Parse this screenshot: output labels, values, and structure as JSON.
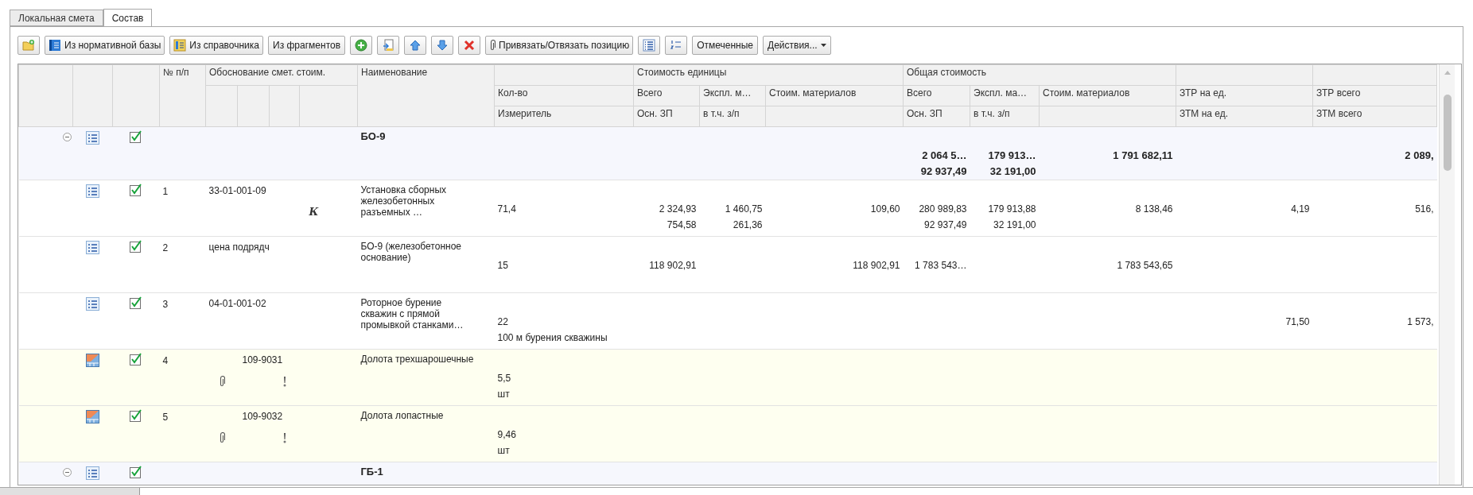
{
  "tabs": [
    {
      "label": "Локальная смета",
      "selected": false
    },
    {
      "label": "Состав",
      "selected": true
    }
  ],
  "toolbar": [
    {
      "kind": "icon"
    },
    {
      "kind": "icon_text",
      "label": "Из нормативной базы"
    },
    {
      "kind": "icon_text",
      "label": "Из справочника"
    },
    {
      "kind": "text",
      "label": "Из фрагментов"
    },
    {
      "kind": "icon"
    },
    {
      "kind": "icon"
    },
    {
      "kind": "icon"
    },
    {
      "kind": "icon"
    },
    {
      "kind": "icon"
    },
    {
      "kind": "icon_text",
      "label": "Привязать/Отвязать позицию"
    },
    {
      "kind": "icon"
    },
    {
      "kind": "icon"
    },
    {
      "kind": "text",
      "label": "Отмеченные"
    },
    {
      "kind": "menu",
      "label": "Действия..."
    }
  ],
  "table": {
    "number_header": "№ п/п",
    "basis_header": "Обоснование смет. стоим.",
    "name_header": "Наименование",
    "groups": [
      {
        "label": "Стоимость единицы"
      },
      {
        "label": "Общая стоимость"
      }
    ],
    "columns": [
      {
        "label": "Кол-во",
        "sublabel": "Измеритель"
      },
      {
        "label": "Всего",
        "sublabel": "Осн. ЗП"
      },
      {
        "label": "Экспл. м…",
        "sublabel": "в т.ч. з/п"
      },
      {
        "label": "Стоим. материалов"
      },
      {
        "label": "Всего",
        "sublabel": "Осн. ЗП"
      },
      {
        "label": "Экспл. ма…",
        "sublabel": "в т.ч. з/п"
      },
      {
        "label": "Стоим. материалов"
      },
      {
        "label": "ЗТР на ед.",
        "sublabel": "ЗТМ на ед."
      },
      {
        "label": "ЗТР всего",
        "sublabel": "ЗТМ всего"
      }
    ],
    "rows": [
      {
        "kind": "group",
        "expanded": true,
        "checked": true,
        "name": "БО-9",
        "total": "2 064 5…",
        "total_base_wage": "92 937,49",
        "total_machine": "179 913…",
        "total_machine_wage": "32 191,00",
        "total_materials": "1 791 682,11",
        "ztr_total": "2 089,"
      },
      {
        "kind": "item",
        "checked": true,
        "attached": false,
        "warning": false,
        "number": "1",
        "code": "33-01-001-09",
        "coefficient_mark": "К",
        "name": "Установка сборных железобетонных разъемных …",
        "quantity": "71,4",
        "unit_total": "2 324,93",
        "unit_base_wage": "754,58",
        "unit_machine": "1 460,75",
        "unit_machine_wage": "261,36",
        "unit_materials": "109,60",
        "total": "280 989,83",
        "total_base_wage": "92 937,49",
        "total_machine": "179 913,88",
        "total_machine_wage": "32 191,00",
        "total_materials": "8 138,46",
        "ztr_unit": "4,19",
        "ztr_total": "516,"
      },
      {
        "kind": "item",
        "checked": true,
        "attached": false,
        "warning": false,
        "number": "2",
        "code": "цена подрядч",
        "name": "БО-9 (железобетонное основание)",
        "quantity": "15",
        "unit_total": "118 902,91",
        "unit_materials": "118 902,91",
        "total": "1 783 543…",
        "total_materials": "1 783 543,65"
      },
      {
        "kind": "item",
        "checked": true,
        "attached": false,
        "warning": false,
        "number": "3",
        "code": "04-01-001-02",
        "name": "Роторное бурение скважин с прямой промывкой станками…",
        "quantity": "22",
        "unit": "100 м бурения скважины",
        "ztr_unit": "71,50",
        "ztr_total": "1 573,"
      },
      {
        "kind": "material",
        "checked": true,
        "attached": true,
        "warning": true,
        "number": "4",
        "code": "109-9031",
        "name": "Долота трехшарошечные",
        "quantity": "5,5",
        "unit": "шт"
      },
      {
        "kind": "material",
        "checked": true,
        "attached": true,
        "warning": true,
        "number": "5",
        "code": "109-9032",
        "name": "Долота лопастные",
        "quantity": "9,46",
        "unit": "шт"
      },
      {
        "kind": "group",
        "expanded": true,
        "checked": true,
        "name": "ГБ-1"
      }
    ]
  }
}
